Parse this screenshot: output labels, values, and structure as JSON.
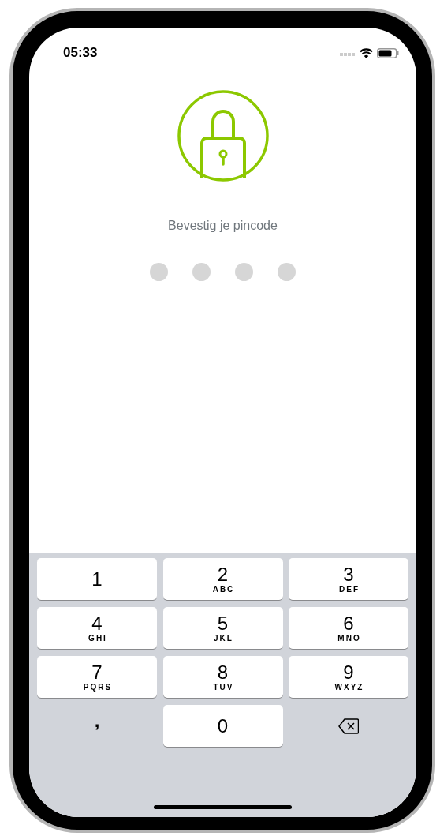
{
  "status_bar": {
    "time": "05:33"
  },
  "prompt": "Bevestig je pincode",
  "pin_dots": [
    {
      "filled": false
    },
    {
      "filled": false
    },
    {
      "filled": false
    },
    {
      "filled": false
    }
  ],
  "keypad": [
    {
      "kind": "digit",
      "digit": "1"
    },
    {
      "kind": "digit",
      "digit": "2",
      "letters": "ABC"
    },
    {
      "kind": "digit",
      "digit": "3",
      "letters": "DEF"
    },
    {
      "kind": "digit",
      "digit": "4",
      "letters": "GHI"
    },
    {
      "kind": "digit",
      "digit": "5",
      "letters": "JKL"
    },
    {
      "kind": "digit",
      "digit": "6",
      "letters": "MNO"
    },
    {
      "kind": "digit",
      "digit": "7",
      "letters": "PQRS"
    },
    {
      "kind": "digit",
      "digit": "8",
      "letters": "TUV"
    },
    {
      "kind": "digit",
      "digit": "9",
      "letters": "WXYZ"
    },
    {
      "kind": "symbol",
      "digit": ","
    },
    {
      "kind": "digit",
      "digit": "0"
    },
    {
      "kind": "delete"
    }
  ]
}
